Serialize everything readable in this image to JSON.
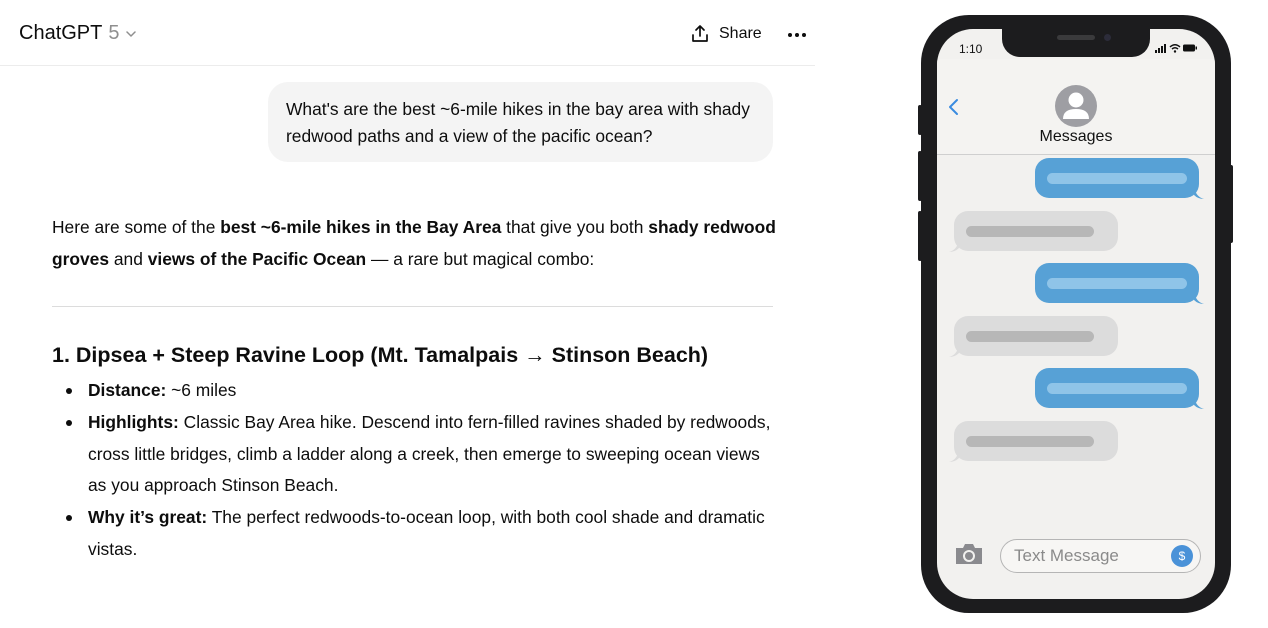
{
  "header": {
    "model_name": "ChatGPT",
    "model_version": "5",
    "share_label": "Share",
    "icons": {
      "model_menu": "chevron-down-icon",
      "share": "share-upload-icon",
      "more": "more-horizontal-icon"
    }
  },
  "user_message": "What's are the best ~6-mile hikes in the bay area with shady redwood paths and a view of the pacific ocean?",
  "answer": {
    "intro": [
      {
        "text": "Here are some of the ",
        "bold": false
      },
      {
        "text": "best ~6-mile hikes in the Bay Area",
        "bold": true
      },
      {
        "text": " that give you both ",
        "bold": false
      },
      {
        "text": "shady redwood groves",
        "bold": true
      },
      {
        "text": " and ",
        "bold": false
      },
      {
        "text": "views of the Pacific Ocean",
        "bold": true
      },
      {
        "text": " — a rare but magical combo:",
        "bold": false
      }
    ],
    "section_title": "1. Dipsea + Steep Ravine Loop (Mt. Tamalpais → Stinson Beach)",
    "bullets": [
      {
        "label": "Distance:",
        "text": " ~6 miles"
      },
      {
        "label": "Highlights:",
        "text": " Classic Bay Area hike. Descend into fern-filled ravines shaded by redwoods, cross little bridges, climb a ladder along a creek, then emerge to sweeping ocean views as you approach Stinson Beach."
      },
      {
        "label": "Why it’s great:",
        "text": " The perfect redwoods-to-ocean loop, with both cool shade and dramatic vistas."
      }
    ]
  },
  "phone": {
    "time": "1:10",
    "contact_label": "Messages",
    "input_placeholder": "Text Message",
    "appstore_glyph": "$",
    "colors": {
      "outgoing": "#57a1d6",
      "incoming": "#dcdcdc",
      "frame": "#1c1c1e",
      "screen": "#f2f1ef"
    },
    "icons": {
      "back": "back-chevron-icon",
      "avatar": "person-avatar-icon",
      "camera": "camera-icon",
      "appstore": "app-store-icon",
      "signal": "signal-icon",
      "wifi": "wifi-icon",
      "battery": "battery-icon"
    },
    "messages": [
      {
        "side": "out"
      },
      {
        "side": "in"
      },
      {
        "side": "out"
      },
      {
        "side": "in"
      },
      {
        "side": "out"
      },
      {
        "side": "in"
      }
    ]
  }
}
